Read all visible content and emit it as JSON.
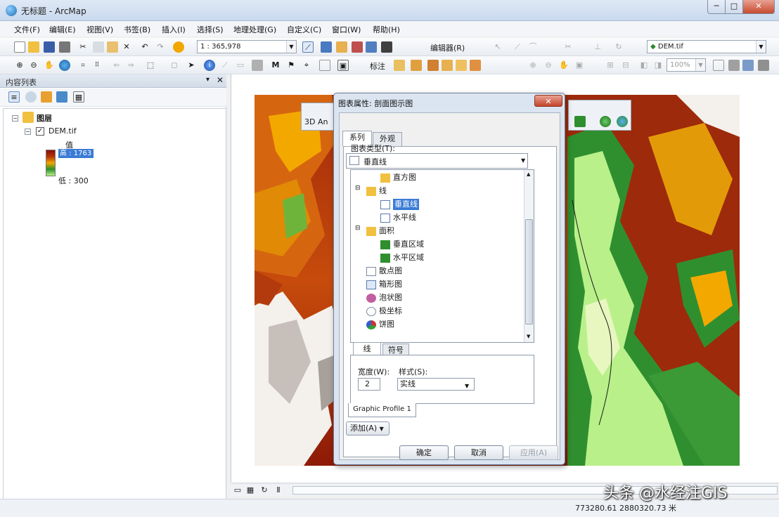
{
  "window": {
    "title": "无标题 - ArcMap",
    "close": "✕",
    "maximize": "□",
    "minimize": "─"
  },
  "menu": [
    "文件(F)",
    "编辑(E)",
    "视图(V)",
    "书签(B)",
    "插入(I)",
    "选择(S)",
    "地理处理(G)",
    "自定义(C)",
    "窗口(W)",
    "帮助(H)"
  ],
  "toolbar1": {
    "scale": "1 : 365,978",
    "editor_label": "编辑器(R)",
    "layer_combo": "DEM.tif"
  },
  "toolbar2": {
    "georef_label": "标注",
    "zoom_percent": "100%"
  },
  "toc": {
    "title": "内容列表",
    "pin": "▾",
    "close": "✕",
    "root_layer": "图层",
    "layer_name": "DEM.tif",
    "value_label": "值",
    "high": "高 : 1763",
    "low": "低 : 300"
  },
  "floating_toolbar": {
    "label": "3D An"
  },
  "dialog": {
    "title": "图表属性: 剖面图示图",
    "close": "✕",
    "tabs": [
      "系列",
      "外观"
    ],
    "type_label": "图表类型(T):",
    "type_value": "垂直线",
    "tree": [
      {
        "label": "直方图",
        "indent": 2
      },
      {
        "label": "线",
        "indent": 1,
        "expander": "⊟"
      },
      {
        "label": "垂直线",
        "indent": 2,
        "selected": true
      },
      {
        "label": "水平线",
        "indent": 2
      },
      {
        "label": "面积",
        "indent": 1,
        "expander": "⊟"
      },
      {
        "label": "垂直区域",
        "indent": 2
      },
      {
        "label": "水平区域",
        "indent": 2
      },
      {
        "label": "散点图",
        "indent": 1
      },
      {
        "label": "箱形图",
        "indent": 1
      },
      {
        "label": "泡状图",
        "indent": 1
      },
      {
        "label": "极坐标",
        "indent": 1
      },
      {
        "label": "饼图",
        "indent": 1
      }
    ],
    "subtabs": [
      "线",
      "符号"
    ],
    "width_label": "宽度(W):",
    "width_value": "2",
    "style_label": "样式(S):",
    "style_value": "实线",
    "graph_tab": "Graphic Profile 1",
    "add_button": "添加(A)",
    "ok": "确定",
    "cancel": "取消",
    "apply": "应用(A)"
  },
  "statusbar": {
    "coords": "773280.61  2880320.73 米"
  },
  "watermark": "头条 @水经注GIS"
}
